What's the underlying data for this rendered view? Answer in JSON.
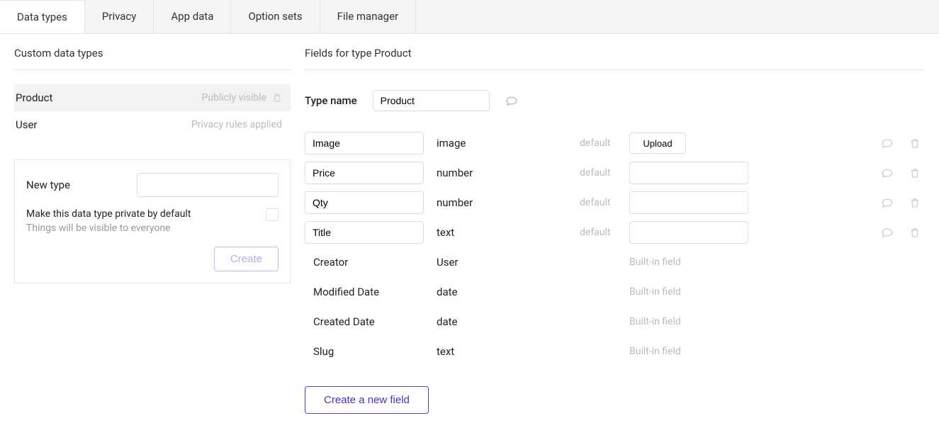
{
  "tabs": [
    {
      "label": "Data types"
    },
    {
      "label": "Privacy"
    },
    {
      "label": "App data"
    },
    {
      "label": "Option sets"
    },
    {
      "label": "File manager"
    }
  ],
  "left": {
    "section_title": "Custom data types",
    "types": [
      {
        "name": "Product",
        "visibility": "Publicly visible"
      },
      {
        "name": "User",
        "visibility": "Privacy rules applied"
      }
    ],
    "new_type": {
      "label": "New type",
      "value": "",
      "private_label": "Make this data type private by default",
      "private_sub": "Things will be visible to everyone",
      "create_label": "Create"
    }
  },
  "right": {
    "section_title": "Fields for type Product",
    "type_name_label": "Type name",
    "type_name_value": "Product",
    "fields": [
      {
        "name": "Image",
        "type": "image",
        "default_kind": "upload",
        "default_label": "default",
        "upload_label": "Upload",
        "editable": true
      },
      {
        "name": "Price",
        "type": "number",
        "default_kind": "input",
        "default_label": "default",
        "default_value": "",
        "editable": true
      },
      {
        "name": "Qty",
        "type": "number",
        "default_kind": "input",
        "default_label": "default",
        "default_value": "",
        "editable": true
      },
      {
        "name": "Title",
        "type": "text",
        "default_kind": "input",
        "default_label": "default",
        "default_value": "",
        "editable": true
      },
      {
        "name": "Creator",
        "type": "User",
        "builtin": "Built-in field",
        "editable": false
      },
      {
        "name": "Modified Date",
        "type": "date",
        "builtin": "Built-in field",
        "editable": false
      },
      {
        "name": "Created Date",
        "type": "date",
        "builtin": "Built-in field",
        "editable": false
      },
      {
        "name": "Slug",
        "type": "text",
        "builtin": "Built-in field",
        "editable": false
      }
    ],
    "create_field_label": "Create a new field"
  }
}
